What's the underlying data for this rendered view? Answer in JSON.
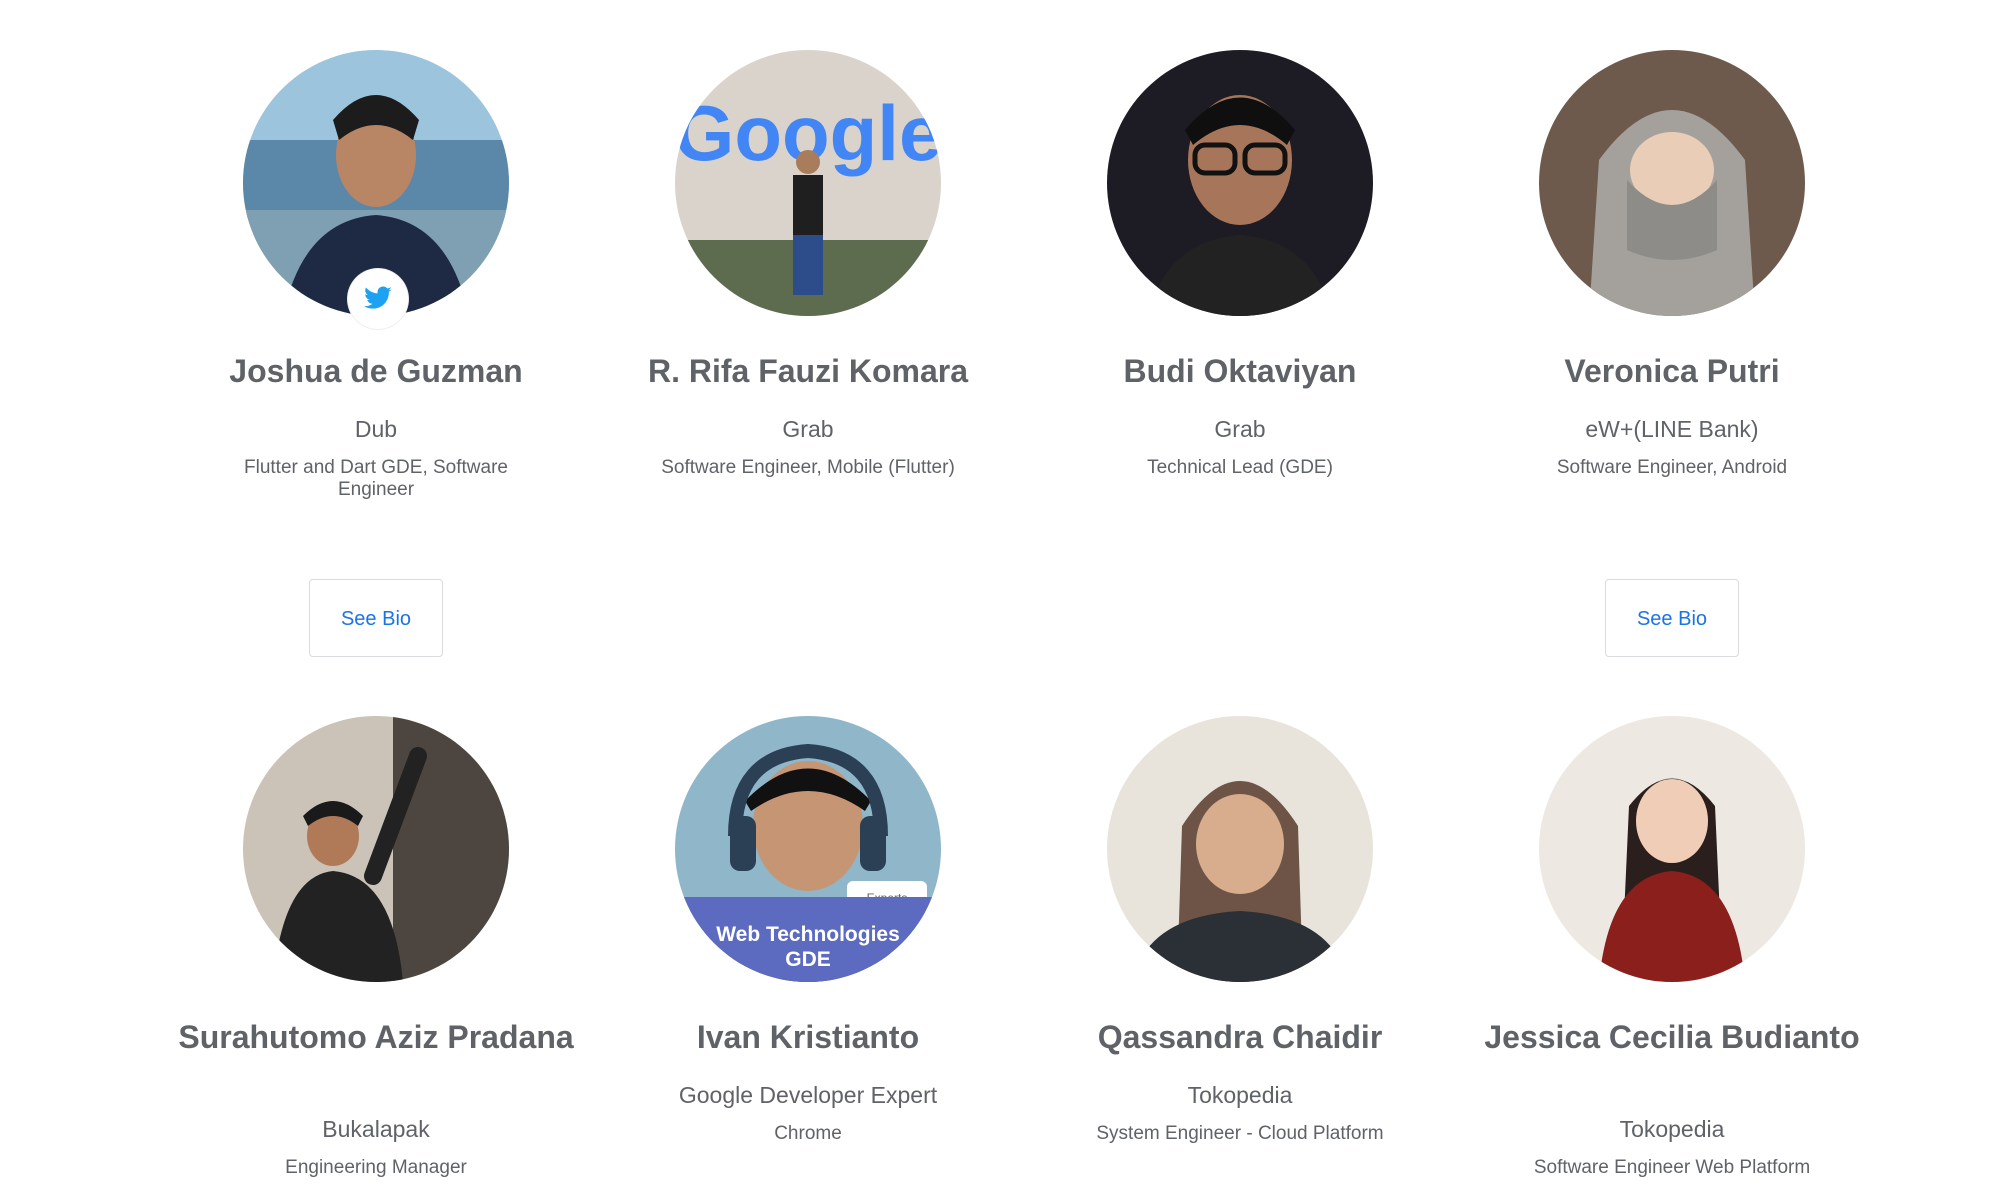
{
  "speakers": [
    {
      "name": "Joshua de Guzman",
      "company": "Dub",
      "role": "Flutter and Dart GDE, Software Engineer",
      "bio_label": "See Bio",
      "avatar_icon": "twitter-icon"
    },
    {
      "name": "R. Rifa Fauzi Komara",
      "company": "Grab",
      "role": "Software Engineer, Mobile (Flutter)"
    },
    {
      "name": "Budi Oktaviyan",
      "company": "Grab",
      "role": "Technical Lead (GDE)"
    },
    {
      "name": "Veronica Putri",
      "company": "eW+(LINE Bank)",
      "role": "Software Engineer, Android",
      "bio_label": "See Bio"
    },
    {
      "name": "Surahutomo Aziz Pradana",
      "company": "Bukalapak",
      "role": "Engineering Manager"
    },
    {
      "name": "Ivan Kristianto",
      "company": "Google Developer Expert",
      "role": "Chrome",
      "badge_text": "Web Technologies GDE",
      "badge_logo": "Experts"
    },
    {
      "name": "Qassandra Chaidir",
      "company": "Tokopedia",
      "role": "System Engineer - Cloud Platform"
    },
    {
      "name": "Jessica Cecilia Budianto",
      "company": "Tokopedia",
      "role": "Software Engineer Web Platform"
    }
  ],
  "photo_logo_text": "Google",
  "colors": {
    "link": "#1a73e8",
    "text": "#5f6368",
    "twitter": "#1da1f2",
    "badge": "#5c6bc0"
  }
}
